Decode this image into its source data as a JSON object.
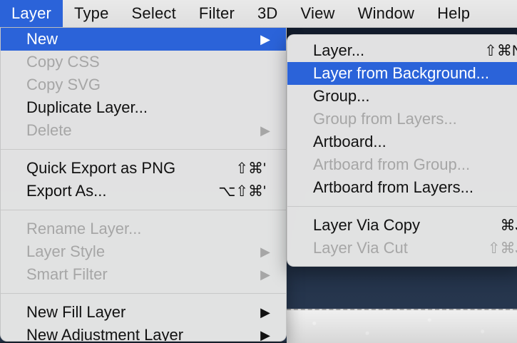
{
  "menubar": {
    "items": [
      {
        "label": "Layer",
        "active": true
      },
      {
        "label": "Type"
      },
      {
        "label": "Select"
      },
      {
        "label": "Filter"
      },
      {
        "label": "3D"
      },
      {
        "label": "View"
      },
      {
        "label": "Window"
      },
      {
        "label": "Help"
      }
    ]
  },
  "layer_menu": {
    "items": [
      {
        "label": "New",
        "disabled": false,
        "highlighted": true,
        "submenu_arrow": "▶"
      },
      {
        "label": "Copy CSS",
        "disabled": true
      },
      {
        "label": "Copy SVG",
        "disabled": true
      },
      {
        "label": "Duplicate Layer...",
        "disabled": false
      },
      {
        "label": "Delete",
        "disabled": true,
        "submenu_arrow": "▶"
      },
      {
        "label": "Quick Export as PNG",
        "disabled": false,
        "shortcut": "⇧⌘'"
      },
      {
        "label": "Export As...",
        "disabled": false,
        "shortcut": "⌥⇧⌘'"
      },
      {
        "label": "Rename Layer...",
        "disabled": true
      },
      {
        "label": "Layer Style",
        "disabled": true,
        "submenu_arrow": "▶"
      },
      {
        "label": "Smart Filter",
        "disabled": true,
        "submenu_arrow": "▶"
      },
      {
        "label": "New Fill Layer",
        "disabled": false,
        "submenu_arrow": "▶"
      },
      {
        "label": "New Adjustment Layer",
        "disabled": false,
        "submenu_arrow": "▶"
      }
    ]
  },
  "new_submenu": {
    "items": [
      {
        "label": "Layer...",
        "disabled": false,
        "shortcut": "⇧⌘N"
      },
      {
        "label": "Layer from Background...",
        "disabled": false,
        "highlighted": true
      },
      {
        "label": "Group...",
        "disabled": false
      },
      {
        "label": "Group from Layers...",
        "disabled": true
      },
      {
        "label": "Artboard...",
        "disabled": false
      },
      {
        "label": "Artboard from Group...",
        "disabled": true
      },
      {
        "label": "Artboard from Layers...",
        "disabled": false
      },
      {
        "label": "Layer Via Copy",
        "disabled": false,
        "shortcut": "⌘J"
      },
      {
        "label": "Layer Via Cut",
        "disabled": true,
        "shortcut": "⇧⌘J"
      }
    ]
  }
}
